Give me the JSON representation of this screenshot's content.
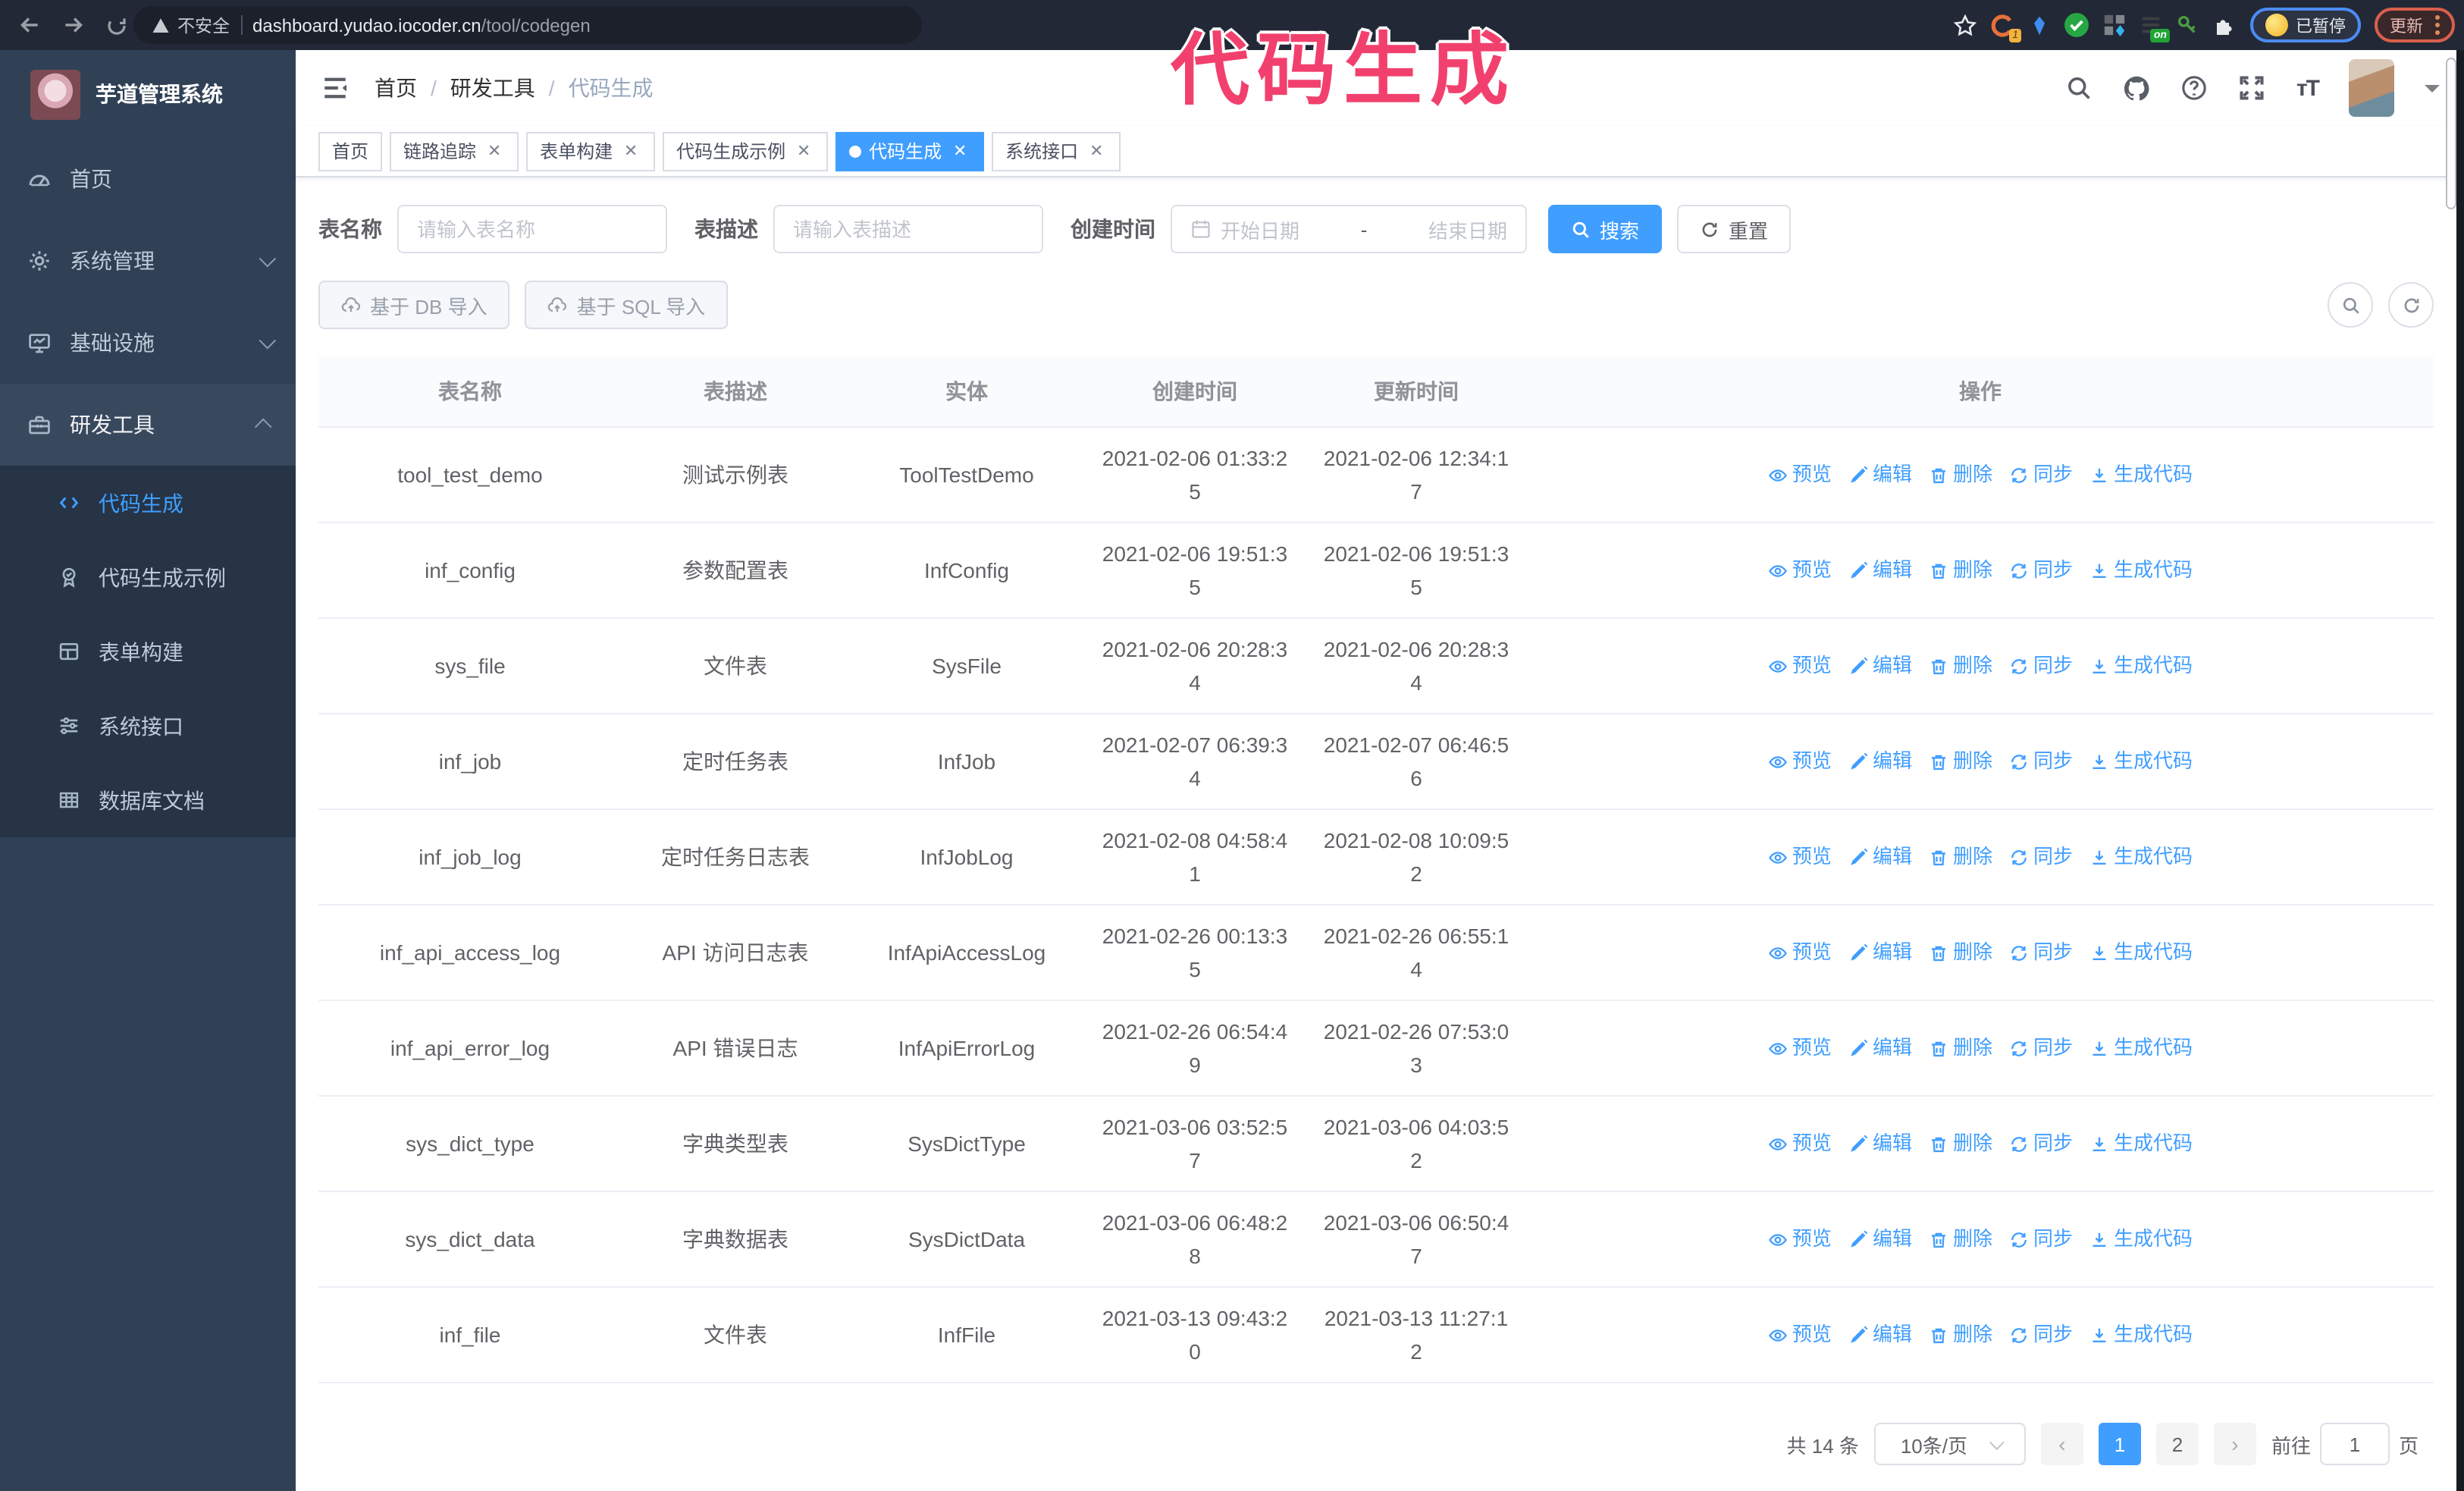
{
  "browser": {
    "security_warning": "不安全",
    "url_host": "dashboard.yudao.iocoder.cn",
    "url_path": "/tool/codegen",
    "extension_badge": "1",
    "extension_on_badge": "on",
    "profile_status": "已暂停",
    "update_button": "更新"
  },
  "annotation": {
    "text": "代码生成",
    "color": "#f2406e"
  },
  "sidebar": {
    "title": "芋道管理系统",
    "items": [
      {
        "label": "首页",
        "icon": "dashboard-icon",
        "chevron": "none",
        "state": "normal"
      },
      {
        "label": "系统管理",
        "icon": "gear-icon",
        "chevron": "down",
        "state": "normal"
      },
      {
        "label": "基础设施",
        "icon": "monitor-icon",
        "chevron": "down",
        "state": "normal"
      },
      {
        "label": "研发工具",
        "icon": "toolbox-icon",
        "chevron": "up",
        "state": "open"
      }
    ],
    "submenu": [
      {
        "label": "代码生成",
        "icon": "code-icon",
        "active": true
      },
      {
        "label": "代码生成示例",
        "icon": "medal-icon",
        "active": false
      },
      {
        "label": "表单构建",
        "icon": "form-icon",
        "active": false
      },
      {
        "label": "系统接口",
        "icon": "sliders-icon",
        "active": false
      },
      {
        "label": "数据库文档",
        "icon": "dbdoc-icon",
        "active": false
      }
    ]
  },
  "header": {
    "breadcrumb": [
      "首页",
      "研发工具",
      "代码生成"
    ]
  },
  "tabs": [
    {
      "label": "首页",
      "closable": false,
      "active": false
    },
    {
      "label": "链路追踪",
      "closable": true,
      "active": false
    },
    {
      "label": "表单构建",
      "closable": true,
      "active": false
    },
    {
      "label": "代码生成示例",
      "closable": true,
      "active": false
    },
    {
      "label": "代码生成",
      "closable": true,
      "active": true
    },
    {
      "label": "系统接口",
      "closable": true,
      "active": false
    }
  ],
  "filters": {
    "table_name_label": "表名称",
    "table_name_placeholder": "请输入表名称",
    "table_desc_label": "表描述",
    "table_desc_placeholder": "请输入表描述",
    "create_time_label": "创建时间",
    "date_start_placeholder": "开始日期",
    "date_separator": "-",
    "date_end_placeholder": "结束日期",
    "search_button": "搜索",
    "reset_button": "重置"
  },
  "toolbar": {
    "import_db_button": "基于 DB 导入",
    "import_sql_button": "基于 SQL 导入"
  },
  "table": {
    "columns": [
      "表名称",
      "表描述",
      "实体",
      "创建时间",
      "更新时间",
      "操作"
    ],
    "action_labels": [
      "预览",
      "编辑",
      "删除",
      "同步",
      "生成代码"
    ],
    "action_icons": [
      "eye-icon",
      "edit-icon",
      "delete-icon",
      "sync-icon",
      "download-icon"
    ],
    "rows": [
      {
        "name": "tool_test_demo",
        "desc": "测试示例表",
        "entity": "ToolTestDemo",
        "created": "2021-02-06 01:33:25",
        "updated": "2021-02-06 12:34:17"
      },
      {
        "name": "inf_config",
        "desc": "参数配置表",
        "entity": "InfConfig",
        "created": "2021-02-06 19:51:35",
        "updated": "2021-02-06 19:51:35"
      },
      {
        "name": "sys_file",
        "desc": "文件表",
        "entity": "SysFile",
        "created": "2021-02-06 20:28:34",
        "updated": "2021-02-06 20:28:34"
      },
      {
        "name": "inf_job",
        "desc": "定时任务表",
        "entity": "InfJob",
        "created": "2021-02-07 06:39:34",
        "updated": "2021-02-07 06:46:56"
      },
      {
        "name": "inf_job_log",
        "desc": "定时任务日志表",
        "entity": "InfJobLog",
        "created": "2021-02-08 04:58:41",
        "updated": "2021-02-08 10:09:52"
      },
      {
        "name": "inf_api_access_log",
        "desc": "API 访问日志表",
        "entity": "InfApiAccessLog",
        "created": "2021-02-26 00:13:35",
        "updated": "2021-02-26 06:55:14"
      },
      {
        "name": "inf_api_error_log",
        "desc": "API 错误日志",
        "entity": "InfApiErrorLog",
        "created": "2021-02-26 06:54:49",
        "updated": "2021-02-26 07:53:03"
      },
      {
        "name": "sys_dict_type",
        "desc": "字典类型表",
        "entity": "SysDictType",
        "created": "2021-03-06 03:52:57",
        "updated": "2021-03-06 04:03:52"
      },
      {
        "name": "sys_dict_data",
        "desc": "字典数据表",
        "entity": "SysDictData",
        "created": "2021-03-06 06:48:28",
        "updated": "2021-03-06 06:50:47"
      },
      {
        "name": "inf_file",
        "desc": "文件表",
        "entity": "InfFile",
        "created": "2021-03-13 09:43:20",
        "updated": "2021-03-13 11:27:12"
      }
    ]
  },
  "pagination": {
    "total": "共 14 条",
    "page_size": "10条/页",
    "pages": [
      "1",
      "2"
    ],
    "active_page": "1",
    "goto_label": "前往",
    "goto_value": "1",
    "goto_suffix": "页"
  },
  "colors": {
    "primary": "#409eff",
    "sidebar": "#304156",
    "submenu": "#263445",
    "annotation": "#f2406e"
  }
}
